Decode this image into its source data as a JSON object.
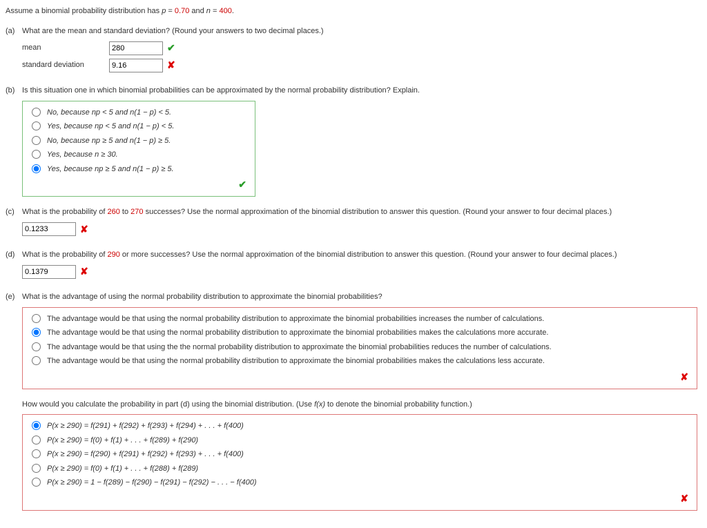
{
  "intro_pre": "Assume a binomial probability distribution has ",
  "intro_p_lhs": "p",
  "intro_eq1": " = ",
  "intro_p_val": "0.70",
  "intro_and": " and ",
  "intro_n_lhs": "n",
  "intro_eq2": " = ",
  "intro_n_val": "400",
  "intro_end": ".",
  "a": {
    "label": "(a)",
    "q": "What are the mean and standard deviation? (Round your answers to two decimal places.)",
    "mean_label": "mean",
    "mean_val": "280",
    "sd_label": "standard deviation",
    "sd_val": "9.16"
  },
  "b": {
    "label": "(b)",
    "q": "Is this situation one in which binomial probabilities can be approximated by the normal probability distribution? Explain.",
    "opts": [
      "No, because np < 5 and n(1 − p) < 5.",
      "Yes, because np < 5 and n(1 − p) < 5.",
      "No, because np ≥ 5 and n(1 − p) ≥ 5.",
      "Yes, because n ≥ 30.",
      "Yes, because np ≥ 5 and n(1 − p) ≥ 5."
    ],
    "selected": 4
  },
  "c": {
    "label": "(c)",
    "q_pre": "What is the probability of ",
    "num1": "260",
    "mid": " to ",
    "num2": "270",
    "q_post": " successes? Use the normal approximation of the binomial distribution to answer this question. (Round your answer to four decimal places.)",
    "val": "0.1233"
  },
  "d": {
    "label": "(d)",
    "q_pre": "What is the probability of ",
    "num1": "290",
    "q_post": " or more successes? Use the normal approximation of the binomial distribution to answer this question. (Round your answer to four decimal places.)",
    "val": "0.1379"
  },
  "e": {
    "label": "(e)",
    "q": "What is the advantage of using the normal probability distribution to approximate the binomial probabilities?",
    "opts": [
      "The advantage would be that using the normal probability distribution to approximate the binomial probabilities increases the number of calculations.",
      "The advantage would be that using the normal probability distribution to approximate the binomial probabilities makes the calculations more accurate.",
      "The advantage would be that using the the normal probability distribution to approximate the binomial probabilities reduces the number of calculations.",
      "The advantage would be that using the normal probability distribution to approximate the binomial probabilities makes the calculations less accurate."
    ],
    "selected": 1
  },
  "f": {
    "q_pre": "How would you calculate the probability in part (d) using the binomial distribution. (Use ",
    "fx": "f(x)",
    "q_post": " to denote the binomial probability function.)",
    "opts": [
      "P(x ≥ 290) = f(291) + f(292) + f(293) + f(294) + . . . + f(400)",
      "P(x ≥ 290) = f(0) + f(1) + . . . + f(289) + f(290)",
      "P(x ≥ 290) = f(290) + f(291) + f(292) + f(293) + . . . + f(400)",
      "P(x ≥ 290) = f(0) + f(1) + . . . + f(288) + f(289)",
      "P(x ≥ 290) = 1 − f(289) − f(290) − f(291) − f(292) − . . . − f(400)"
    ],
    "selected": 0
  },
  "marks": {
    "check": "✔",
    "cross": "✘"
  }
}
